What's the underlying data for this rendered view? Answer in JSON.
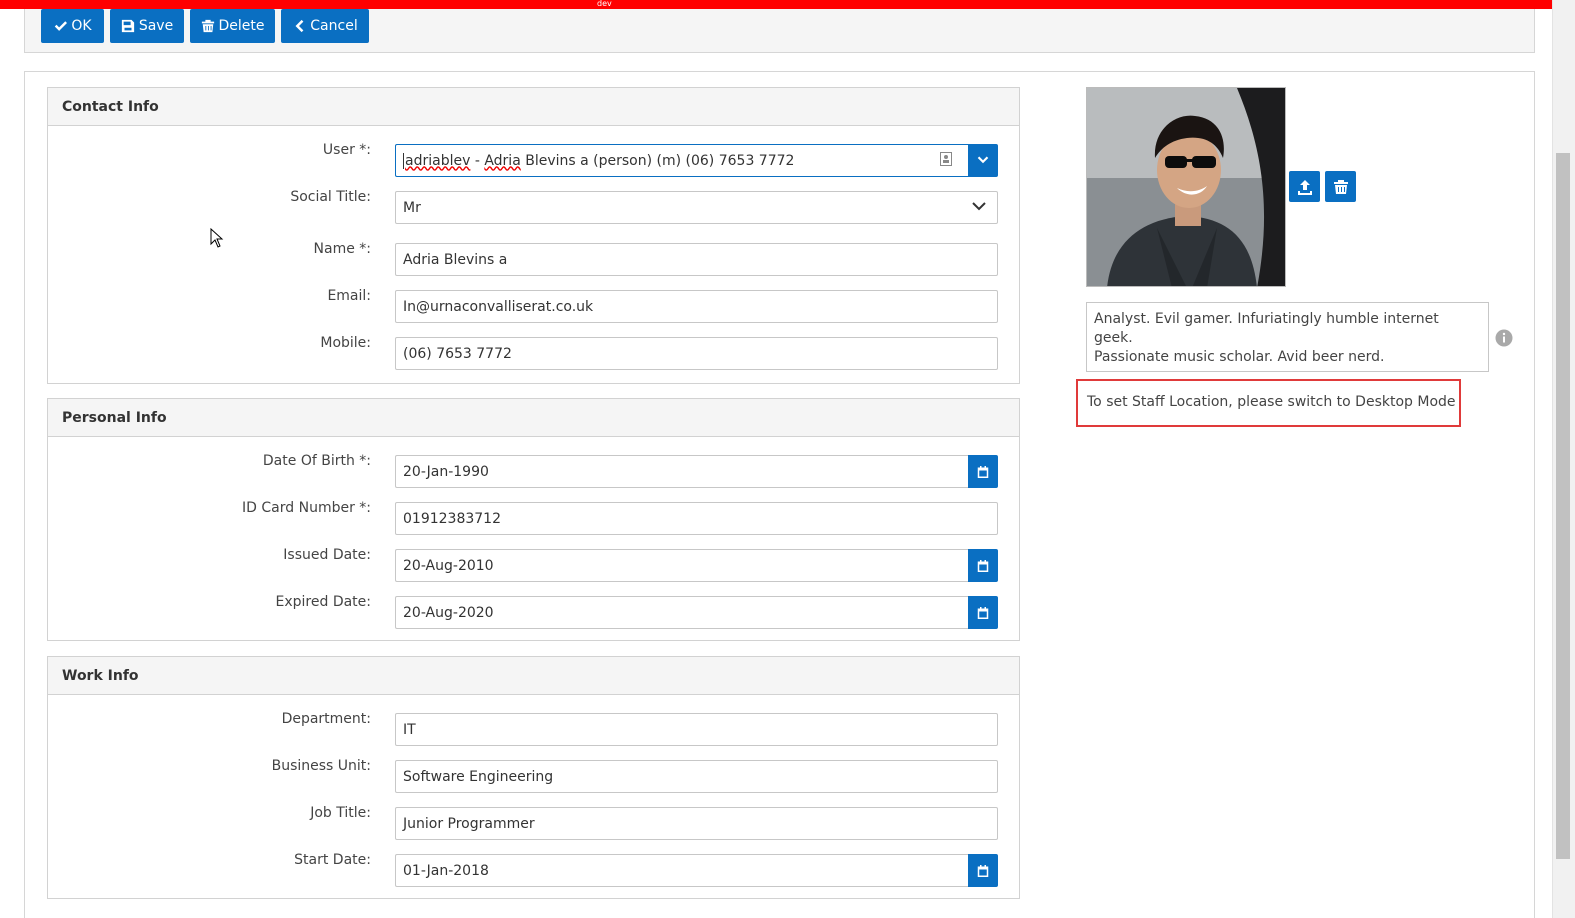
{
  "env_label": "dev",
  "toolbar": {
    "ok_label": "OK",
    "save_label": "Save",
    "delete_label": "Delete",
    "cancel_label": "Cancel"
  },
  "contact": {
    "title": "Contact Info",
    "user_label": "User *:",
    "user_login": "adriablev",
    "user_sep": " - ",
    "user_first": "Adria",
    "user_rest": " Blevins a (person) (m) (06) 7653 7772",
    "social_title_label": "Social Title:",
    "social_title_value": "Mr",
    "name_label": "Name *:",
    "name_value": "Adria Blevins a",
    "email_label": "Email:",
    "email_value": "In@urnaconvalliserat.co.uk",
    "mobile_label": "Mobile:",
    "mobile_value": "(06) 7653 7772"
  },
  "personal": {
    "title": "Personal Info",
    "dob_label": "Date Of Birth *:",
    "dob_value": "20-Jan-1990",
    "id_label": "ID Card Number *:",
    "id_value": "01912383712",
    "issued_label": "Issued Date:",
    "issued_value": "20-Aug-2010",
    "expired_label": "Expired Date:",
    "expired_value": "20-Aug-2020"
  },
  "work": {
    "title": "Work Info",
    "department_label": "Department:",
    "department_value": "IT",
    "bu_label": "Business Unit:",
    "bu_value": "Software Engineering",
    "job_label": "Job Title:",
    "job_value": "Junior Programmer",
    "start_label": "Start Date:",
    "start_value": "01-Jan-2018"
  },
  "profile": {
    "bio_line1": "Analyst. Evil gamer. Infuriatingly humble internet geek.",
    "bio_line2": "Passionate music scholar. Avid beer nerd.",
    "notice": "To set Staff Location, please switch to Desktop Mode"
  },
  "colors": {
    "primary": "#0a6fc2",
    "dev_bar": "#ff0000",
    "notice_border": "#e03a3a"
  },
  "icons": [
    "check-icon",
    "save-icon",
    "trash-icon",
    "chevron-left-icon",
    "chevron-down-icon",
    "calendar-icon",
    "upload-icon",
    "info-icon",
    "contact-card-icon"
  ]
}
